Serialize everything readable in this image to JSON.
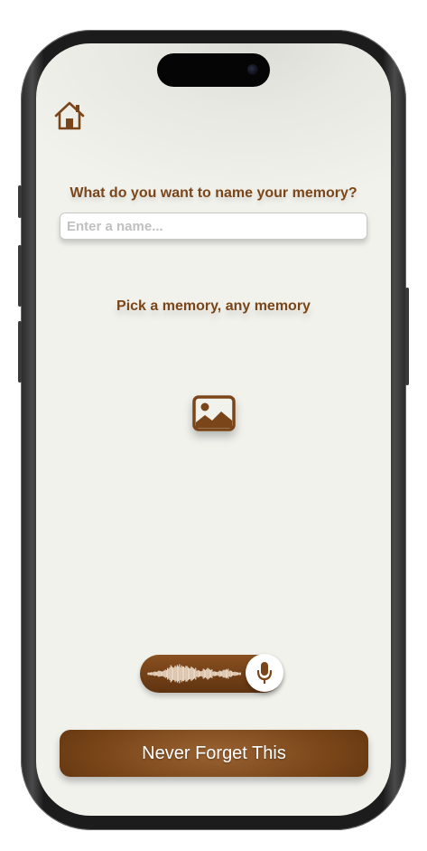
{
  "header": {
    "home_icon": "house-icon"
  },
  "name_section": {
    "prompt": "What do you want to name your memory?",
    "input_placeholder": "Enter a name...",
    "input_value": ""
  },
  "picker_section": {
    "label": "Pick a memory, any memory",
    "icon": "photo-icon"
  },
  "recorder": {
    "waveform_icon": "waveform-icon",
    "mic_icon": "microphone-icon"
  },
  "actions": {
    "primary_label": "Never Forget This"
  },
  "colors": {
    "accent_brown": "#7a4619",
    "dark_brown": "#5a300c",
    "background": "#f2f2ed"
  }
}
